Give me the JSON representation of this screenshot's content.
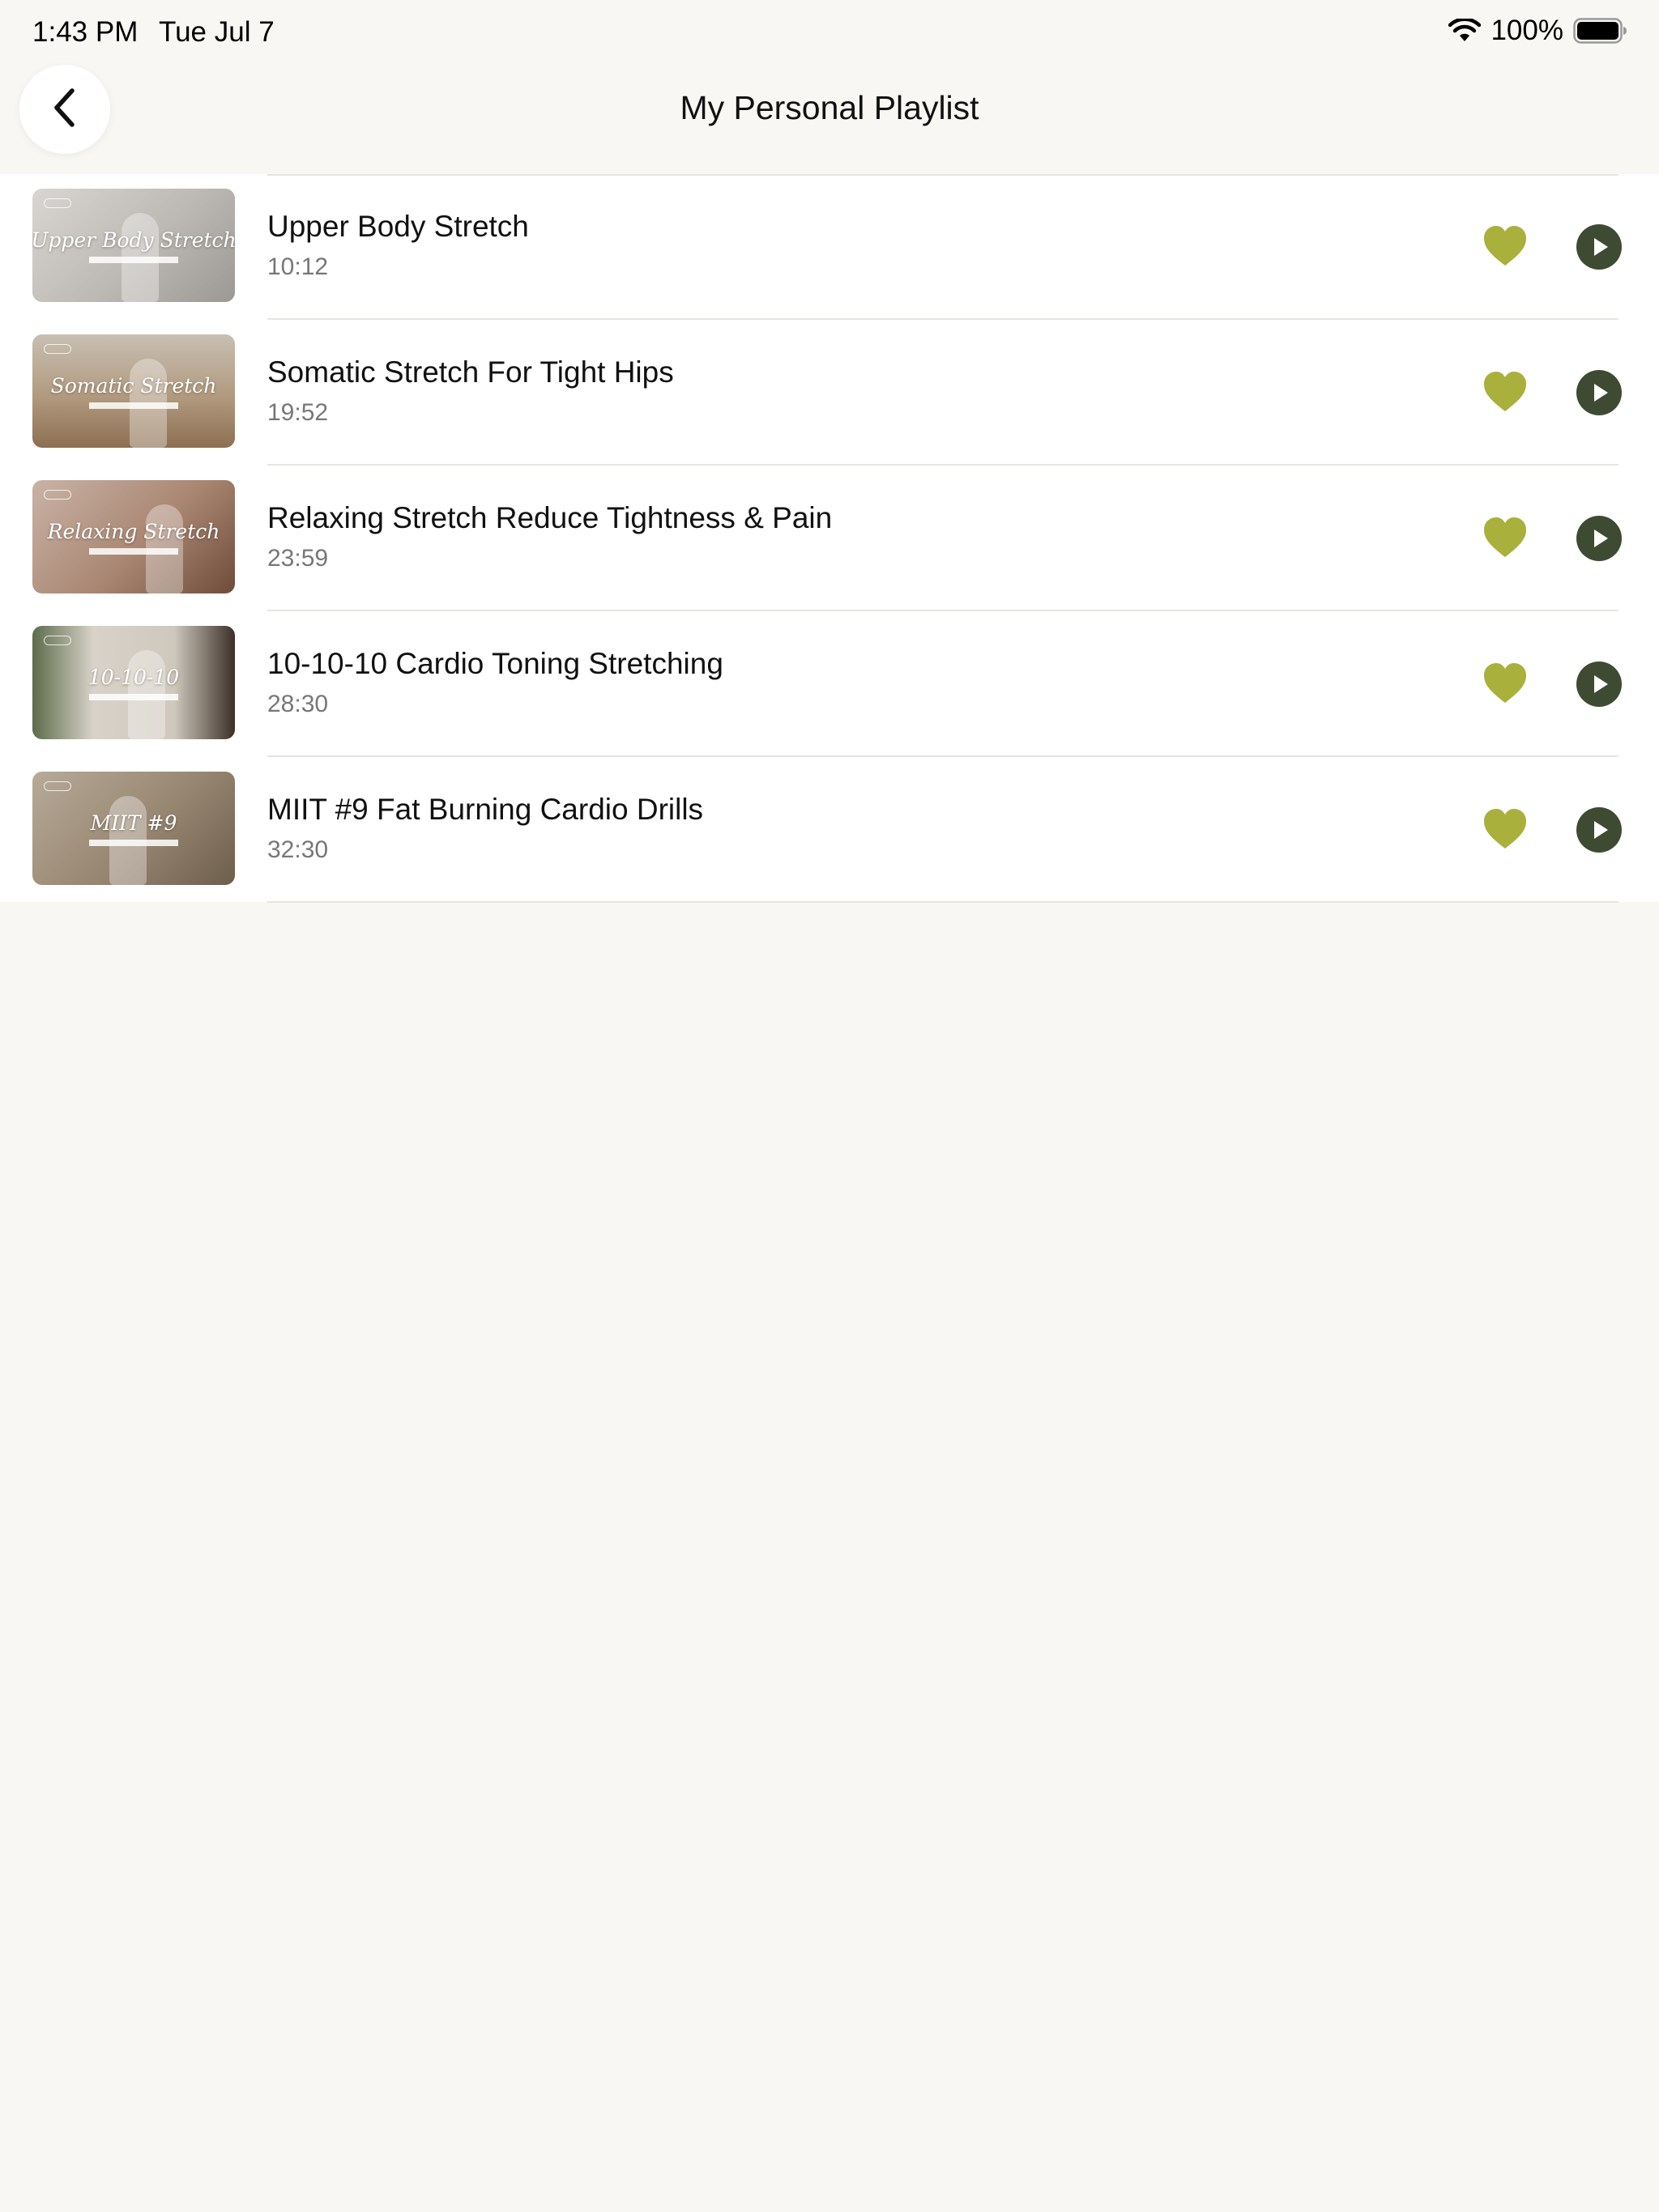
{
  "status_bar": {
    "time": "1:43 PM",
    "date": "Tue Jul 7",
    "battery_percent": "100%",
    "battery_level": 1.0,
    "icons": [
      "wifi-icon",
      "battery-icon"
    ]
  },
  "nav": {
    "back_icon": "chevron-left-icon",
    "title": "My Personal Playlist"
  },
  "colors": {
    "accent_heart": "#a9b03b",
    "play_button": "#3e4a31",
    "background": "#f8f7f4",
    "list_background": "#ffffff"
  },
  "playlist": {
    "items": [
      {
        "title": "Upper Body Stretch",
        "duration": "10:12",
        "thumb_text": "Upper Body Stretch",
        "favorited": true,
        "icons": [
          "heart-icon",
          "play-icon"
        ]
      },
      {
        "title": "Somatic Stretch For Tight Hips",
        "duration": "19:52",
        "thumb_text": "Somatic Stretch",
        "favorited": true,
        "icons": [
          "heart-icon",
          "play-icon"
        ]
      },
      {
        "title": "Relaxing Stretch Reduce Tightness & Pain",
        "duration": "23:59",
        "thumb_text": "Relaxing Stretch",
        "favorited": true,
        "icons": [
          "heart-icon",
          "play-icon"
        ]
      },
      {
        "title": "10-10-10 Cardio Toning Stretching",
        "duration": "28:30",
        "thumb_text": "10-10-10",
        "favorited": true,
        "icons": [
          "heart-icon",
          "play-icon"
        ]
      },
      {
        "title": "MIIT #9 Fat Burning Cardio Drills",
        "duration": "32:30",
        "thumb_text": "MIIT #9",
        "favorited": true,
        "icons": [
          "heart-icon",
          "play-icon"
        ]
      }
    ]
  }
}
